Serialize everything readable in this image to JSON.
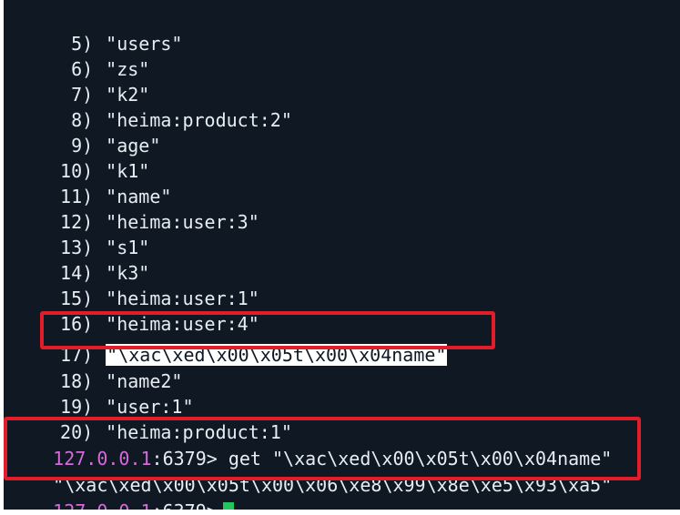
{
  "list": [
    {
      "num": "5)",
      "value": "\"users\""
    },
    {
      "num": "6)",
      "value": "\"zs\""
    },
    {
      "num": "7)",
      "value": "\"k2\""
    },
    {
      "num": "8)",
      "value": "\"heima:product:2\""
    },
    {
      "num": "9)",
      "value": "\"age\""
    },
    {
      "num": "10)",
      "value": "\"k1\""
    },
    {
      "num": "11)",
      "value": "\"name\""
    },
    {
      "num": "12)",
      "value": "\"heima:user:3\""
    },
    {
      "num": "13)",
      "value": "\"s1\""
    },
    {
      "num": "14)",
      "value": "\"k3\""
    },
    {
      "num": "15)",
      "value": "\"heima:user:1\""
    },
    {
      "num": "16)",
      "value": "\"heima:user:4\""
    },
    {
      "num": "17)",
      "value": "\"\\xac\\xed\\x00\\x05t\\x00\\x04name\""
    },
    {
      "num": "18)",
      "value": "\"name2\""
    },
    {
      "num": "19)",
      "value": "\"user:1\""
    },
    {
      "num": "20)",
      "value": "\"heima:product:1\""
    }
  ],
  "prompt": {
    "host": "127.0.0.1",
    "port_suffix": ":6379>"
  },
  "command": " get \"\\xac\\xed\\x00\\x05t\\x00\\x04name\"",
  "output": "\"\\xac\\xed\\x00\\x05t\\x00\\x06\\xe8\\x99\\x8e\\xe5\\x93\\xa5\"",
  "colors": {
    "background": "#0f1823",
    "text": "#e6edf3",
    "prompt_host": "#d46bd9",
    "cursor": "#22c55e",
    "highlight_box": "#e11d2a"
  }
}
